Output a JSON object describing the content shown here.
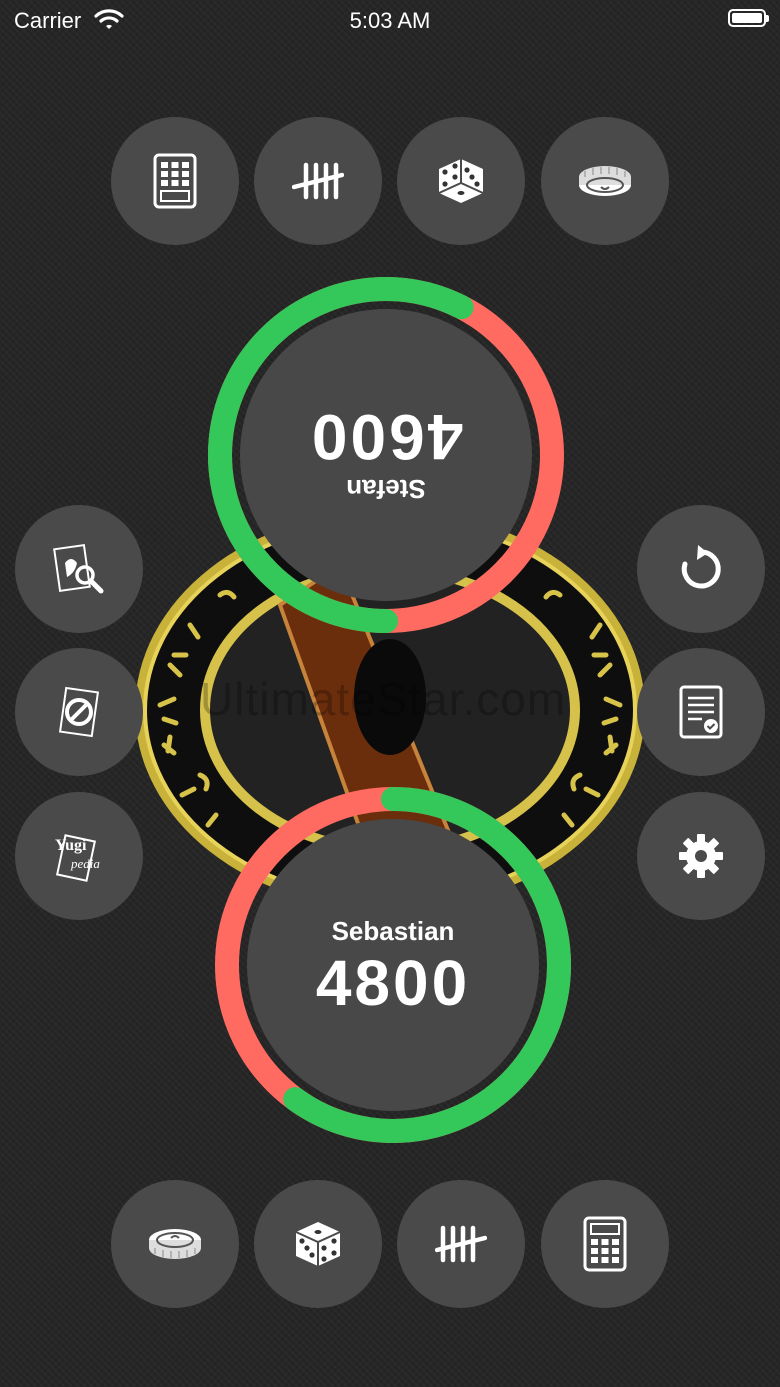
{
  "status_bar": {
    "carrier": "Carrier",
    "time": "5:03 AM"
  },
  "top_toolbar": [
    "calculator-icon",
    "tally-icon",
    "dice-icon",
    "coin-icon"
  ],
  "left_toolbar": [
    "card-search-icon",
    "banned-card-icon",
    "yugipedia-icon"
  ],
  "left_toolbar_logo_text": {
    "line1": "Yugi",
    "line2": "pedia"
  },
  "right_toolbar": [
    "reset-icon",
    "duel-log-icon",
    "gear-icon"
  ],
  "bottom_toolbar": [
    "coin-icon",
    "dice-icon",
    "tally-icon",
    "calculator-icon"
  ],
  "watermark": "UltimateStar.com",
  "players": {
    "top": {
      "name": "Stefan",
      "life": "4600",
      "life_fraction": 0.575
    },
    "bottom": {
      "name": "Sebastian",
      "life": "4800",
      "life_fraction": 0.6
    }
  },
  "colors": {
    "life_remaining": "#34c759",
    "life_lost": "#ff6b61",
    "button": "#4a4a4a",
    "background": "#262626"
  }
}
